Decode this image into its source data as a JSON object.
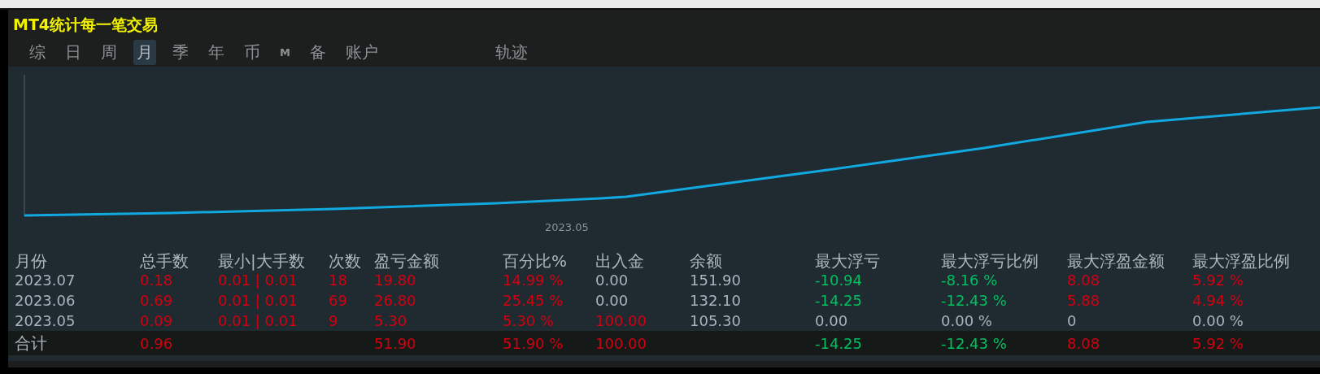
{
  "window": {
    "title": "MT4统计每一笔交易"
  },
  "tabs": [
    {
      "label": "综",
      "selected": false,
      "kind": "text"
    },
    {
      "label": "日",
      "selected": false,
      "kind": "text"
    },
    {
      "label": "周",
      "selected": false,
      "kind": "text"
    },
    {
      "label": "月",
      "selected": true,
      "kind": "text"
    },
    {
      "label": "季",
      "selected": false,
      "kind": "text"
    },
    {
      "label": "年",
      "selected": false,
      "kind": "text"
    },
    {
      "label": "币",
      "selected": false,
      "kind": "text"
    },
    {
      "label": "M",
      "selected": false,
      "kind": "small"
    },
    {
      "label": "备",
      "selected": false,
      "kind": "text"
    },
    {
      "label": "账户",
      "selected": false,
      "kind": "text"
    }
  ],
  "trail_tab": {
    "label": "轨迹"
  },
  "chart": {
    "x_label": "2023.05"
  },
  "table": {
    "columns": [
      "月份",
      "总手数",
      "最小|大手数",
      "次数",
      "盈亏金额",
      "百分比%",
      "出入金",
      "余额",
      "最大浮亏",
      "最大浮亏比例",
      "最大浮盈金额",
      "最大浮盈比例"
    ],
    "rows": [
      {
        "kind": "month",
        "cells": [
          {
            "text": "2023.07",
            "color": "#aab4bc"
          },
          {
            "text": "0.18",
            "color": "#d40010"
          },
          {
            "text": "0.01 | 0.01",
            "color": "#d40010"
          },
          {
            "text": "18",
            "color": "#d40010"
          },
          {
            "text": "19.80",
            "color": "#d40010"
          },
          {
            "text": "14.99 %",
            "color": "#d40010"
          },
          {
            "text": "0.00",
            "color": "#aab4bc"
          },
          {
            "text": "151.90",
            "color": "#aab4bc"
          },
          {
            "text": "-10.94",
            "color": "#00c060"
          },
          {
            "text": "-8.16 %",
            "color": "#00c060"
          },
          {
            "text": "8.08",
            "color": "#d40010"
          },
          {
            "text": "5.92 %",
            "color": "#d40010"
          }
        ]
      },
      {
        "kind": "month",
        "cells": [
          {
            "text": "2023.06",
            "color": "#aab4bc"
          },
          {
            "text": "0.69",
            "color": "#d40010"
          },
          {
            "text": "0.01 | 0.01",
            "color": "#d40010"
          },
          {
            "text": "69",
            "color": "#d40010"
          },
          {
            "text": "26.80",
            "color": "#d40010"
          },
          {
            "text": "25.45 %",
            "color": "#d40010"
          },
          {
            "text": "0.00",
            "color": "#aab4bc"
          },
          {
            "text": "132.10",
            "color": "#aab4bc"
          },
          {
            "text": "-14.25",
            "color": "#00c060"
          },
          {
            "text": "-12.43 %",
            "color": "#00c060"
          },
          {
            "text": "5.88",
            "color": "#d40010"
          },
          {
            "text": "4.94 %",
            "color": "#d40010"
          }
        ]
      },
      {
        "kind": "month",
        "cells": [
          {
            "text": "2023.05",
            "color": "#aab4bc"
          },
          {
            "text": "0.09",
            "color": "#d40010"
          },
          {
            "text": "0.01 | 0.01",
            "color": "#d40010"
          },
          {
            "text": "9",
            "color": "#d40010"
          },
          {
            "text": "5.30",
            "color": "#d40010"
          },
          {
            "text": "5.30 %",
            "color": "#d40010"
          },
          {
            "text": "100.00",
            "color": "#d40010"
          },
          {
            "text": "105.30",
            "color": "#aab4bc"
          },
          {
            "text": "0.00",
            "color": "#aab4bc"
          },
          {
            "text": "0.00 %",
            "color": "#aab4bc"
          },
          {
            "text": "0",
            "color": "#aab4bc"
          },
          {
            "text": "0.00 %",
            "color": "#aab4bc"
          }
        ]
      },
      {
        "kind": "total",
        "cells": [
          {
            "text": "合计",
            "color": "#aab4bc"
          },
          {
            "text": "0.96",
            "color": "#d40010"
          },
          null,
          null,
          {
            "text": "51.90",
            "color": "#d40010"
          },
          {
            "text": "51.90 %",
            "color": "#d40010"
          },
          {
            "text": "100.00",
            "color": "#d40010"
          },
          null,
          {
            "text": "-14.25",
            "color": "#00c060"
          },
          {
            "text": "-12.43 %",
            "color": "#00c060"
          },
          {
            "text": "8.08",
            "color": "#d40010"
          },
          {
            "text": "5.92 %",
            "color": "#d40010"
          }
        ]
      }
    ]
  }
}
